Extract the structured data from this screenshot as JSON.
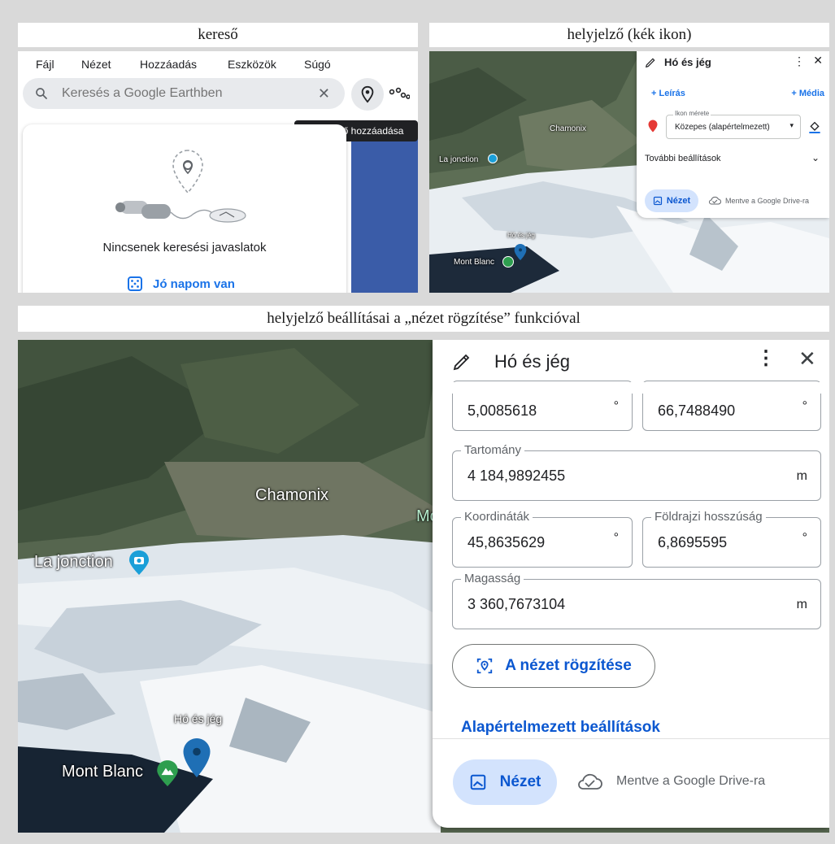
{
  "captions": {
    "search": "kereső",
    "placemark": "helyjelző (kék ikon)",
    "settings": "helyjelző beállításai a „nézet rögzítése” funkcióval"
  },
  "search_panel": {
    "menu": [
      "Fájl",
      "Nézet",
      "Hozzáadás",
      "Eszközök",
      "Súgó"
    ],
    "search_placeholder": "Keresés a Google Earthben",
    "tooltip": "Helyjelző hozzáadása",
    "no_suggestions": "Nincsenek keresési javaslatok",
    "lucky": "Jó napom van",
    "icons": {
      "search": "search-icon",
      "clear": "close-icon",
      "pin": "add-placemark-icon",
      "path": "path-icon",
      "lucky": "dice-icon"
    }
  },
  "small_panel": {
    "map_labels": {
      "chamonix": "Chamonix",
      "la_jonction": "La jonction",
      "mont_blanc": "Mont Blanc",
      "placemark": "Hó és jég"
    },
    "card": {
      "title": "Hó és jég",
      "add_description": "+ Leírás",
      "add_media": "+ Média",
      "icon_size_label": "Ikon mérete",
      "icon_size_value": "Közepes (alapértelmezett)",
      "more_settings": "További beállítások",
      "view_button": "Nézet",
      "saved_text": "Mentve a Google Drive-ra"
    }
  },
  "big_panel": {
    "map_labels": {
      "chamonix": "Chamonix",
      "la_jonction": "La jonction",
      "mont_blanc": "Mont Blanc",
      "placemark": "Hó és jég",
      "partial": "Mo"
    },
    "card": {
      "title": "Hó és jég",
      "field_top_left": {
        "value": "5,0085618",
        "unit": "°"
      },
      "field_top_right": {
        "value": "66,7488490",
        "unit": "°"
      },
      "range": {
        "label": "Tartomány",
        "value": "4 184,9892455",
        "unit": "m"
      },
      "latitude": {
        "label": "Koordináták",
        "value": "45,8635629",
        "unit": "°"
      },
      "longitude": {
        "label": "Földrajzi hosszúság",
        "value": "6,8695595",
        "unit": "°"
      },
      "altitude": {
        "label": "Magasság",
        "value": "3 360,7673104",
        "unit": "m"
      },
      "fix_view_button": "A nézet rögzítése",
      "default_settings": "Alapértelmezett beállítások",
      "view_button": "Nézet",
      "saved_text": "Mentve a Google Drive-ra"
    }
  },
  "colors": {
    "accent_blue": "#0b57d0",
    "placemark_blue": "#1f6fb5",
    "mountain_green": "#2e9e4f",
    "pin_red": "#e53935"
  }
}
